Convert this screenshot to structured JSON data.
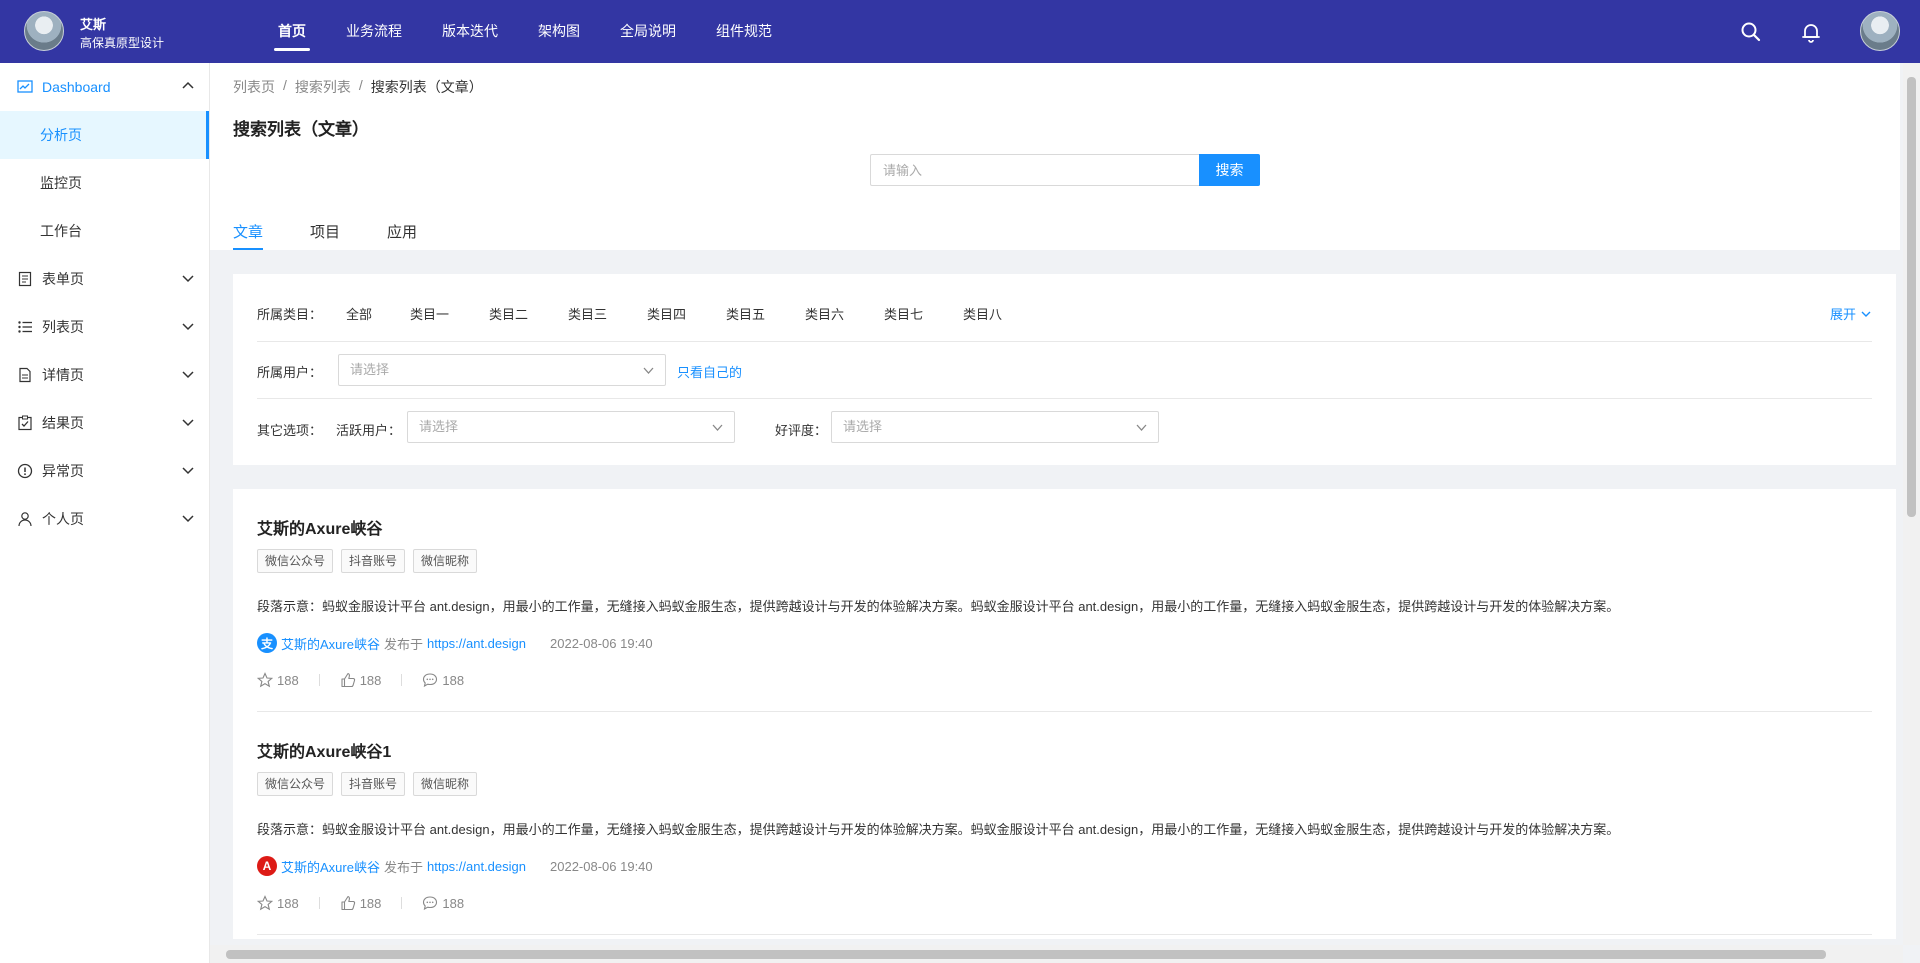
{
  "brand": {
    "name": "艾斯",
    "subtitle": "高保真原型设计"
  },
  "topnav": [
    "首页",
    "业务流程",
    "版本迭代",
    "架构图",
    "全局说明",
    "组件规范"
  ],
  "sidebar": {
    "dashboard": {
      "label": "Dashboard",
      "children": [
        "分析页",
        "监控页",
        "工作台"
      ]
    },
    "groups": [
      {
        "label": "表单页",
        "icon": "form-icon"
      },
      {
        "label": "列表页",
        "icon": "list-icon"
      },
      {
        "label": "详情页",
        "icon": "detail-icon"
      },
      {
        "label": "结果页",
        "icon": "result-icon"
      },
      {
        "label": "异常页",
        "icon": "warning-icon"
      },
      {
        "label": "个人页",
        "icon": "user-icon"
      }
    ]
  },
  "breadcrumb": [
    "列表页",
    "搜索列表",
    "搜索列表（文章）"
  ],
  "page_title": "搜索列表（文章）",
  "search": {
    "placeholder": "请输入",
    "button": "搜索"
  },
  "tabs": [
    "文章",
    "项目",
    "应用"
  ],
  "filters": {
    "category_label": "所属类目：",
    "categories": [
      "全部",
      "类目一",
      "类目二",
      "类目三",
      "类目四",
      "类目五",
      "类目六",
      "类目七",
      "类目八"
    ],
    "expand": "展开",
    "owner_label": "所属用户：",
    "owner_placeholder": "请选择",
    "owner_link": "只看自己的",
    "other_label": "其它选项：",
    "active_label": "活跃用户：",
    "active_placeholder": "请选择",
    "rating_label": "好评度：",
    "rating_placeholder": "请选择"
  },
  "articles": [
    {
      "title": "艾斯的Axure峡谷",
      "tags": [
        "微信公众号",
        "抖音账号",
        "微信昵称"
      ],
      "desc": "段落示意：蚂蚁金服设计平台 ant.design，用最小的工作量，无缝接入蚂蚁金服生态，提供跨越设计与开发的体验解决方案。蚂蚁金服设计平台 ant.design，用最小的工作量，无缝接入蚂蚁金服生态，提供跨越设计与开发的体验解决方案。",
      "logo": "支",
      "logo_color": "#1890ff",
      "author": "艾斯的Axure峡谷",
      "published": "发布于",
      "link": "https://ant.design",
      "time": "2022-08-06 19:40",
      "stars": "188",
      "likes": "188",
      "comments": "188"
    },
    {
      "title": "艾斯的Axure峡谷1",
      "tags": [
        "微信公众号",
        "抖音账号",
        "微信昵称"
      ],
      "desc": "段落示意：蚂蚁金服设计平台 ant.design，用最小的工作量，无缝接入蚂蚁金服生态，提供跨越设计与开发的体验解决方案。蚂蚁金服设计平台 ant.design，用最小的工作量，无缝接入蚂蚁金服生态，提供跨越设计与开发的体验解决方案。",
      "logo": "A",
      "logo_color": "#dd1b16",
      "author": "艾斯的Axure峡谷",
      "published": "发布于",
      "link": "https://ant.design",
      "time": "2022-08-06 19:40",
      "stars": "188",
      "likes": "188",
      "comments": "188"
    }
  ],
  "colors": {
    "header": "#3336a3",
    "primary": "#1890ff"
  }
}
